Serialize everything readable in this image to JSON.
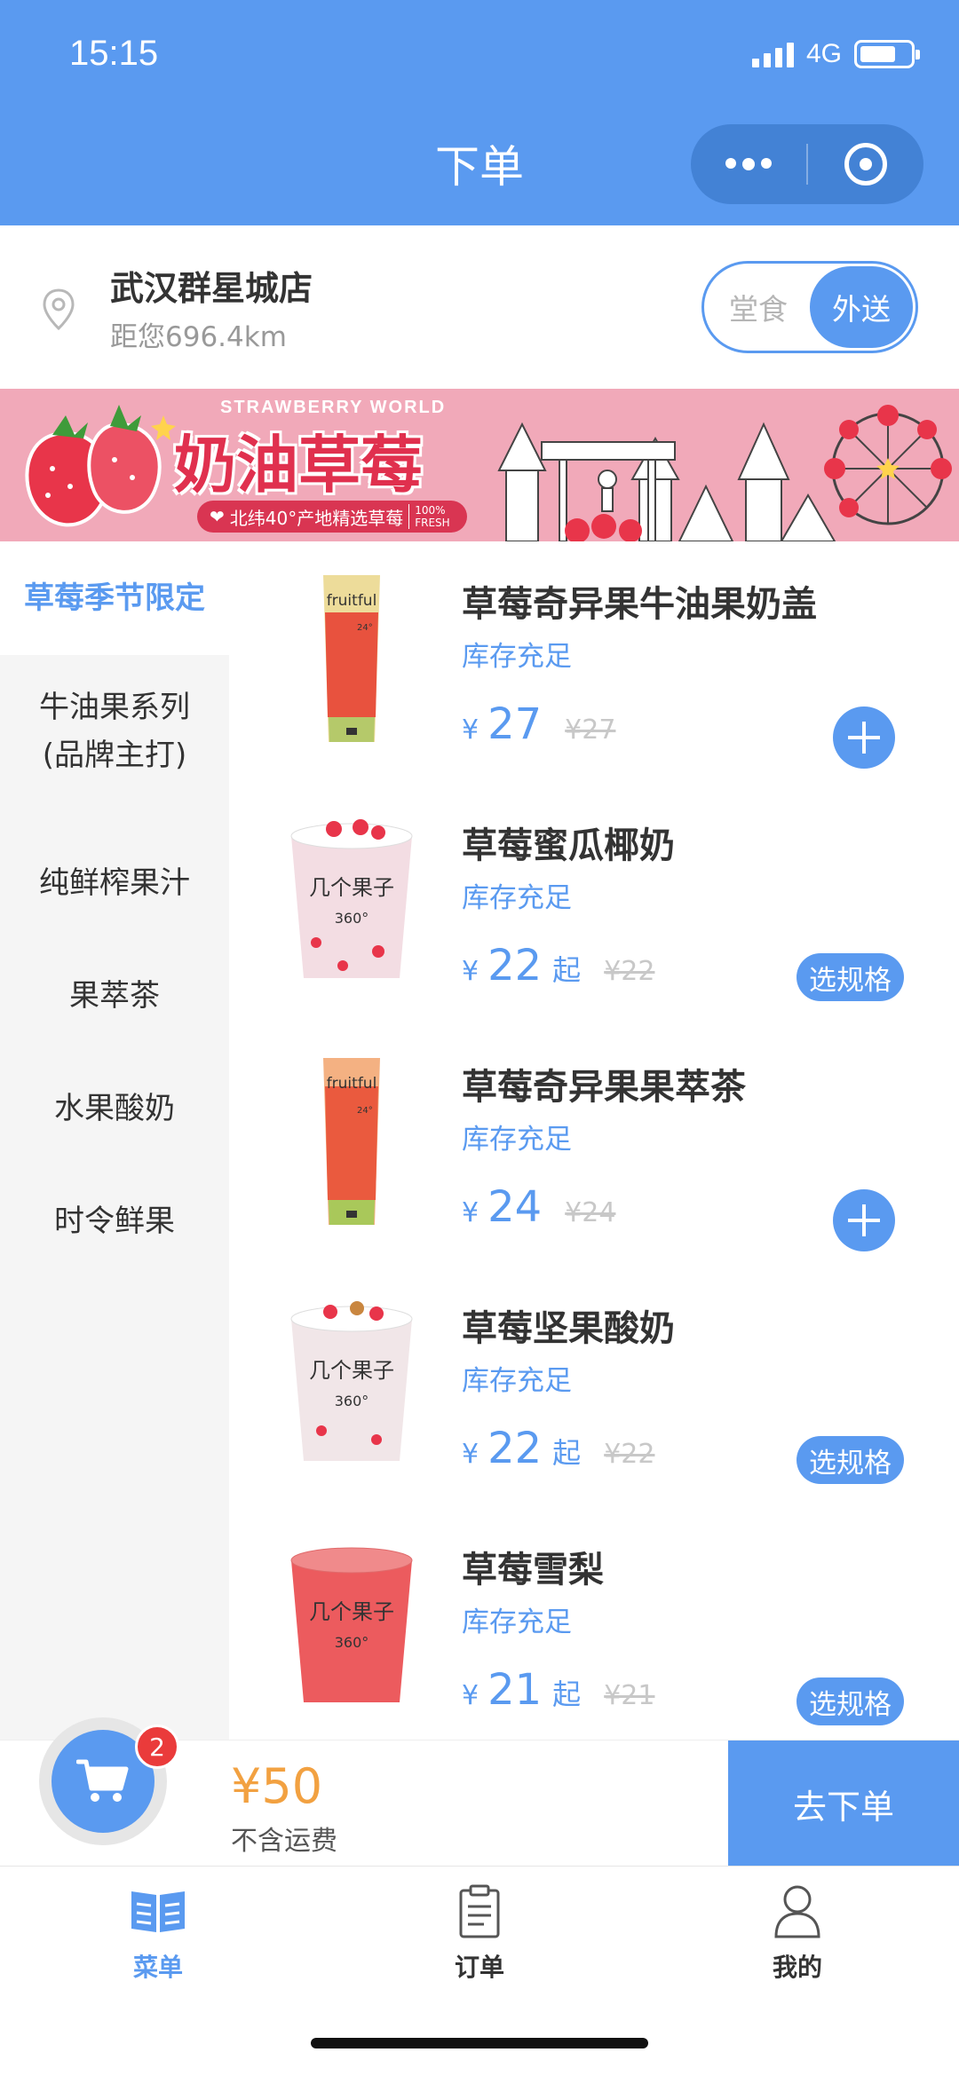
{
  "status_bar": {
    "time": "15:15",
    "network": "4G",
    "battery_level": 0.72
  },
  "nav": {
    "title": "下单",
    "more_icon": "more-dots-icon",
    "close_icon": "target-circle-icon"
  },
  "store": {
    "name": "武汉群星城店",
    "distance": "距您696.4km",
    "modes": [
      "堂食",
      "外送"
    ],
    "selected_mode": "外送"
  },
  "banner": {
    "title_en": "STRAWBERRY WORLD",
    "title": "奶油草莓",
    "subtitle": "北纬40°产地精选草莓",
    "badge": "100% FRESH"
  },
  "categories": [
    {
      "label": "草莓季节限定",
      "active": true
    },
    {
      "label": "牛油果系列\n(品牌主打)",
      "line1": "牛油果系列",
      "line2": "(品牌主打)"
    },
    {
      "label": "纯鲜榨果汁"
    },
    {
      "label": "果萃茶"
    },
    {
      "label": "水果酸奶"
    },
    {
      "label": "时令鲜果"
    }
  ],
  "products": [
    {
      "name": "草莓奇异果牛油果奶盖",
      "stock": "库存充足",
      "currency": "¥",
      "price": "27",
      "suffix": "",
      "original_price": "¥27",
      "action": "add",
      "cup": "fruitful",
      "cup_text": "fruitful",
      "cup_sub": "24°"
    },
    {
      "name": "草莓蜜瓜椰奶",
      "stock": "库存充足",
      "currency": "¥",
      "price": "22",
      "suffix": "起",
      "original_price": "¥22",
      "action": "spec",
      "action_label": "选规格",
      "cup": "wide",
      "cup_text": "几个果子",
      "cup_sub": "360°"
    },
    {
      "name": "草莓奇异果果萃茶",
      "stock": "库存充足",
      "currency": "¥",
      "price": "24",
      "suffix": "",
      "original_price": "¥24",
      "action": "add",
      "cup": "fruitful",
      "cup_text": "fruitful",
      "cup_sub": "24°"
    },
    {
      "name": "草莓坚果酸奶",
      "stock": "库存充足",
      "currency": "¥",
      "price": "22",
      "suffix": "起",
      "original_price": "¥22",
      "action": "spec",
      "action_label": "选规格",
      "cup": "wide",
      "cup_text": "几个果子",
      "cup_sub": "360°"
    },
    {
      "name": "草莓雪梨",
      "stock": "库存充足",
      "currency": "¥",
      "price": "21",
      "suffix": "起",
      "original_price": "¥21",
      "action": "spec",
      "action_label": "选规格",
      "cup": "wide-red",
      "cup_text": "几个果子",
      "cup_sub": "360°"
    }
  ],
  "cart": {
    "count": "2",
    "total": "¥50",
    "note": "不含运费",
    "checkout_label": "去下单"
  },
  "tabbar": [
    {
      "label": "菜单",
      "icon": "menu-book-icon",
      "active": true
    },
    {
      "label": "订单",
      "icon": "clipboard-icon",
      "active": false
    },
    {
      "label": "我的",
      "icon": "user-icon",
      "active": false
    }
  ],
  "colors": {
    "primary": "#5a9af0",
    "price_orange": "#f2a141",
    "badge_red": "#ea3b3b",
    "banner_pink": "#f1a9b9"
  }
}
